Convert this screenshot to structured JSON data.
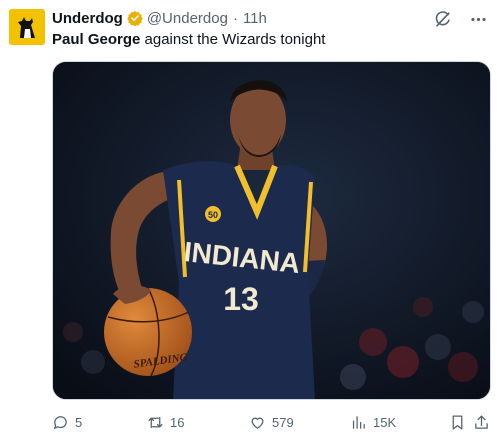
{
  "tweet": {
    "author_name": "Underdog",
    "handle": "@Underdog",
    "separator": "·",
    "time": "11h",
    "text_bold": "Paul George",
    "text_rest": " against the Wizards tonight",
    "icons": {
      "avatar": "underdog-dog-logo",
      "verified": "verified-badge-icon",
      "grok": "grok-icon",
      "more": "more-icon"
    },
    "colors": {
      "avatar_bg": "#f2c200",
      "verified": "#e8b000",
      "muted": "#536471"
    }
  },
  "media": {
    "jersey_text": "INDIANA",
    "jersey_number": "13",
    "badge": "50",
    "ball_text": "SPALDING"
  },
  "actions": {
    "replies": "5",
    "reposts": "16",
    "likes": "579",
    "views": "15K"
  }
}
